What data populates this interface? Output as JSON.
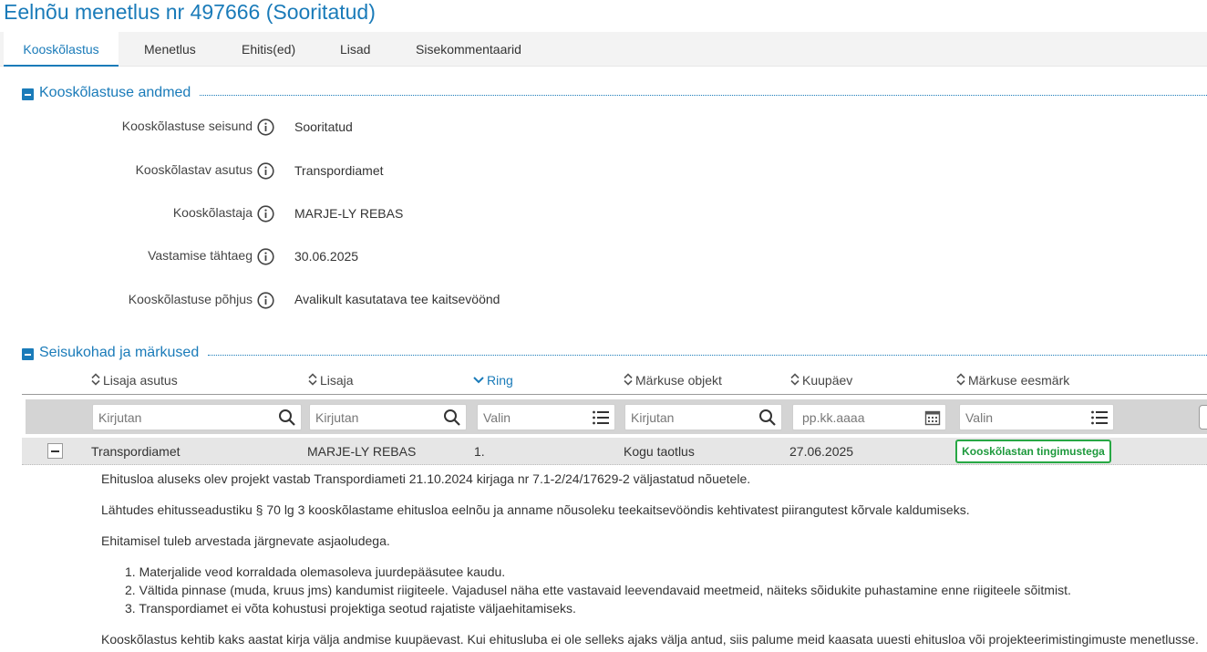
{
  "page": {
    "title": "Eelnõu menetlus nr 497666 (Sooritatud)"
  },
  "tabs": [
    "Kooskõlastus",
    "Menetlus",
    "Ehitis(ed)",
    "Lisad",
    "Sisekommentaarid"
  ],
  "section1": {
    "title": "Kooskõlastuse andmed",
    "fields": [
      {
        "label": "Kooskõlastuse seisund",
        "value": "Sooritatud"
      },
      {
        "label": "Kooskõlastav asutus",
        "value": "Transpordiamet"
      },
      {
        "label": "Kooskõlastaja",
        "value": "MARJE-LY REBAS"
      },
      {
        "label": "Vastamise tähtaeg",
        "value": "30.06.2025"
      },
      {
        "label": "Kooskõlastuse põhjus",
        "value": "Avalikult kasutatava tee kaitsevöönd"
      }
    ]
  },
  "section2": {
    "title": "Seisukohad ja märkused",
    "columns": [
      "Lisaja asutus",
      "Lisaja",
      "Ring",
      "Märkuse objekt",
      "Kuupäev",
      "Märkuse eesmärk"
    ],
    "sorted_column": "Ring",
    "filters": [
      {
        "placeholder": "Kirjutan",
        "icon": "search-icon"
      },
      {
        "placeholder": "Kirjutan",
        "icon": "search-icon"
      },
      {
        "placeholder": "Valin",
        "icon": "list-icon"
      },
      {
        "placeholder": "Kirjutan",
        "icon": "search-icon"
      },
      {
        "placeholder": "pp.kk.aaaa",
        "icon": "calendar-icon"
      },
      {
        "placeholder": "Valin",
        "icon": "list-icon"
      }
    ],
    "row": {
      "lisaja_asutus": "Transpordiamet",
      "lisaja": "MARJE-LY REBAS",
      "ring": "1.",
      "objekt": "Kogu taotlus",
      "kuupaev": "27.06.2025",
      "eesmark": "Kooskõlastan tingimustega"
    },
    "details": {
      "p1": "Ehitusloa aluseks olev projekt vastab Transpordiameti 21.10.2024 kirjaga nr 7.1-2/24/17629-2 väljastatud nõuetele.",
      "p2": "Lähtudes ehitusseadustiku § 70 lg 3 kooskõlastame ehitusloa eelnõu ja anname nõusoleku teekaitsevööndis kehtivatest piirangutest kõrvale kaldumiseks.",
      "p3": "Ehitamisel tuleb arvestada järgnevate asjaoludega.",
      "items": [
        "1. Materjalide veod korraldada olemasoleva juurdepääsutee kaudu.",
        "2. Vältida pinnase (muda, kruus jms) kandumist riigiteele. Vajadusel näha ette vastavaid leevendavaid meetmeid, näiteks sõidukite puhastamine enne riigiteele sõitmist.",
        "3. Transpordiamet ei võta kohustusi projektiga seotud rajatiste väljaehitamiseks."
      ],
      "p4": "Kooskõlastus kehtib kaks aastat kirja välja andmise kuupäevast. Kui ehitusluba ei ole selleks ajaks välja antud, siis palume meid kaasata uuesti ehitusloa või projekteerimistingimuste menetlusse."
    }
  },
  "colors": {
    "accent": "#1a7bb9",
    "badge_green": "#27a844"
  }
}
